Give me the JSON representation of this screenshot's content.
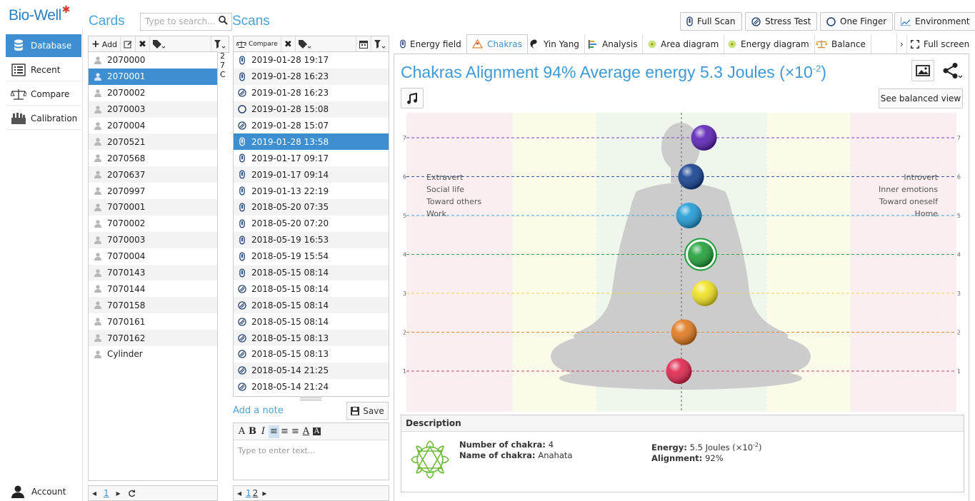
{
  "app": {
    "logo": "Bio-Well",
    "logo_star": "✱"
  },
  "nav": {
    "items": [
      {
        "label": "Database",
        "icon": "database-icon"
      },
      {
        "label": "Recent",
        "icon": "recent-list-icon"
      },
      {
        "label": "Compare",
        "icon": "scale-icon"
      },
      {
        "label": "Calibration",
        "icon": "calibration-icon"
      }
    ],
    "account": "Account"
  },
  "cards": {
    "title": "Cards",
    "search_placeholder": "Type to search...",
    "toolbar": {
      "add": "Add"
    },
    "side_letters": [
      "2",
      "7",
      "C"
    ],
    "items": [
      "2070000",
      "2070001",
      "2070002",
      "2070003",
      "2070004",
      "2070521",
      "2070568",
      "2070637",
      "2070997",
      "7070001",
      "7070002",
      "7070003",
      "7070004",
      "7070143",
      "7070144",
      "7070158",
      "7070161",
      "7070162",
      "Cylinder"
    ],
    "selected_index": 1,
    "pager": {
      "page": "1"
    }
  },
  "scans": {
    "title": "Scans",
    "toolbar": {
      "compare": "Compare"
    },
    "items": [
      {
        "type": "full",
        "date": "2019-01-28 19:17"
      },
      {
        "type": "full",
        "date": "2019-01-28 16:23"
      },
      {
        "type": "stress",
        "date": "2019-01-28 16:23"
      },
      {
        "type": "one",
        "date": "2019-01-28 15:08"
      },
      {
        "type": "stress",
        "date": "2019-01-28 15:07"
      },
      {
        "type": "full",
        "date": "2019-01-28 13:58"
      },
      {
        "type": "full",
        "date": "2019-01-17 09:17"
      },
      {
        "type": "full",
        "date": "2019-01-17 09:14"
      },
      {
        "type": "full",
        "date": "2019-01-13 22:19"
      },
      {
        "type": "full",
        "date": "2018-05-20 07:35"
      },
      {
        "type": "full",
        "date": "2018-05-20 07:20"
      },
      {
        "type": "full",
        "date": "2018-05-19 16:53"
      },
      {
        "type": "full",
        "date": "2018-05-19 15:54"
      },
      {
        "type": "full",
        "date": "2018-05-15 08:14"
      },
      {
        "type": "stress",
        "date": "2018-05-15 08:14"
      },
      {
        "type": "stress",
        "date": "2018-05-15 08:14"
      },
      {
        "type": "stress",
        "date": "2018-05-15 08:14"
      },
      {
        "type": "stress",
        "date": "2018-05-15 08:13"
      },
      {
        "type": "stress",
        "date": "2018-05-15 08:13"
      },
      {
        "type": "stress",
        "date": "2018-05-14 21:25"
      },
      {
        "type": "stress",
        "date": "2018-05-14 21:24"
      }
    ],
    "selected_index": 5,
    "note_link": "Add a note",
    "save": "Save",
    "note_placeholder": "Type to enter text...",
    "pager": {
      "page_a": "1",
      "page_b": "2"
    }
  },
  "top_buttons": {
    "full_scan": "Full Scan",
    "stress_test": "Stress Test",
    "one_finger": "One Finger",
    "environment": "Environment"
  },
  "tabs": {
    "items": [
      "Energy field",
      "Chakras",
      "Yin Yang",
      "Analysis",
      "Area diagram",
      "Energy diagram",
      "Balance"
    ],
    "active_index": 1,
    "fullscreen": "Full screen"
  },
  "chakras": {
    "title_main": "Chakras Alignment 94% Average energy 5.3 Joules (×10",
    "title_exp": "-2",
    "title_end": ")",
    "balanced_view": "See balanced view",
    "left_text": [
      "Extravert",
      "Social life",
      "Toward others",
      "Work"
    ],
    "right_text": [
      "Introvert",
      "Inner emotions",
      "Toward oneself",
      "Home"
    ],
    "levels": [
      "1",
      "2",
      "3",
      "4",
      "5",
      "6",
      "7"
    ],
    "level_colors": {
      "1": "#d93a6b",
      "2": "#e08a30",
      "3": "#e8d84a",
      "4": "#2fa34a",
      "5": "#3aa7d8",
      "6": "#2c5aa8",
      "7": "#7b3fc4"
    },
    "chakras": [
      {
        "level": 1,
        "offset": -0.12,
        "color": "#e0234d"
      },
      {
        "level": 2,
        "offset": 0.12,
        "color": "#e0781c"
      },
      {
        "level": 3,
        "offset": 1.1,
        "color": "#f2e31f"
      },
      {
        "level": 4,
        "offset": 0.9,
        "color": "#1ea038",
        "selected": true
      },
      {
        "level": 5,
        "offset": 0.35,
        "color": "#1e9ad6"
      },
      {
        "level": 6,
        "offset": 0.45,
        "color": "#123f8f"
      },
      {
        "level": 7,
        "offset": 1.05,
        "color": "#5a20b8"
      }
    ]
  },
  "description": {
    "heading": "Description",
    "number_label": "Number of chakra:",
    "number_value": "4",
    "name_label": "Name of chakra:",
    "name_value": "Anahata",
    "energy_label": "Energy:",
    "energy_value": "5.5 Joules (×10",
    "energy_exp": "-2",
    "energy_end": ")",
    "alignment_label": "Alignment:",
    "alignment_value": "92%"
  }
}
